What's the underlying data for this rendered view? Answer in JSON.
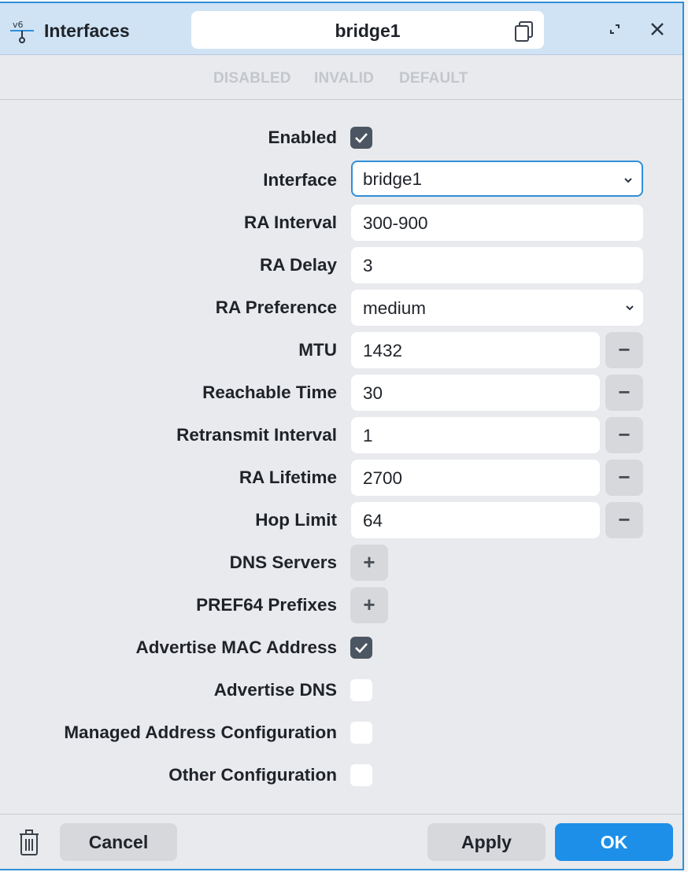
{
  "window": {
    "app_title": "Interfaces",
    "app_icon": "ipv6-network-icon",
    "name": "bridge1",
    "copy_icon": "copy-icon",
    "expand_icon": "expand-icon",
    "close_icon": "close-icon"
  },
  "status": {
    "disabled": "DISABLED",
    "invalid": "INVALID",
    "default": "DEFAULT"
  },
  "form": {
    "enabled": {
      "label": "Enabled",
      "checked": true
    },
    "interface": {
      "label": "Interface",
      "value": "bridge1"
    },
    "ra_interval": {
      "label": "RA Interval",
      "value": "300-900"
    },
    "ra_delay": {
      "label": "RA Delay",
      "value": "3"
    },
    "ra_preference": {
      "label": "RA Preference",
      "value": "medium"
    },
    "mtu": {
      "label": "MTU",
      "value": "1432",
      "remove": "−"
    },
    "reachable_time": {
      "label": "Reachable Time",
      "value": "30",
      "remove": "−"
    },
    "retransmit_interval": {
      "label": "Retransmit Interval",
      "value": "1",
      "remove": "−"
    },
    "ra_lifetime": {
      "label": "RA Lifetime",
      "value": "2700",
      "remove": "−"
    },
    "hop_limit": {
      "label": "Hop Limit",
      "value": "64",
      "remove": "−"
    },
    "dns_servers": {
      "label": "DNS Servers",
      "add": "+"
    },
    "pref64_prefixes": {
      "label": "PREF64 Prefixes",
      "add": "+"
    },
    "advertise_mac": {
      "label": "Advertise MAC Address",
      "checked": true
    },
    "advertise_dns": {
      "label": "Advertise DNS",
      "checked": false
    },
    "managed_address": {
      "label": "Managed Address Configuration",
      "checked": false
    },
    "other_config": {
      "label": "Other Configuration",
      "checked": false
    }
  },
  "footer": {
    "trash_icon": "trash-icon",
    "cancel": "Cancel",
    "apply": "Apply",
    "ok": "OK"
  },
  "colors": {
    "accent": "#1d8fe8",
    "titlebar": "#cfe3f4",
    "checkbox_on": "#4c5663"
  }
}
